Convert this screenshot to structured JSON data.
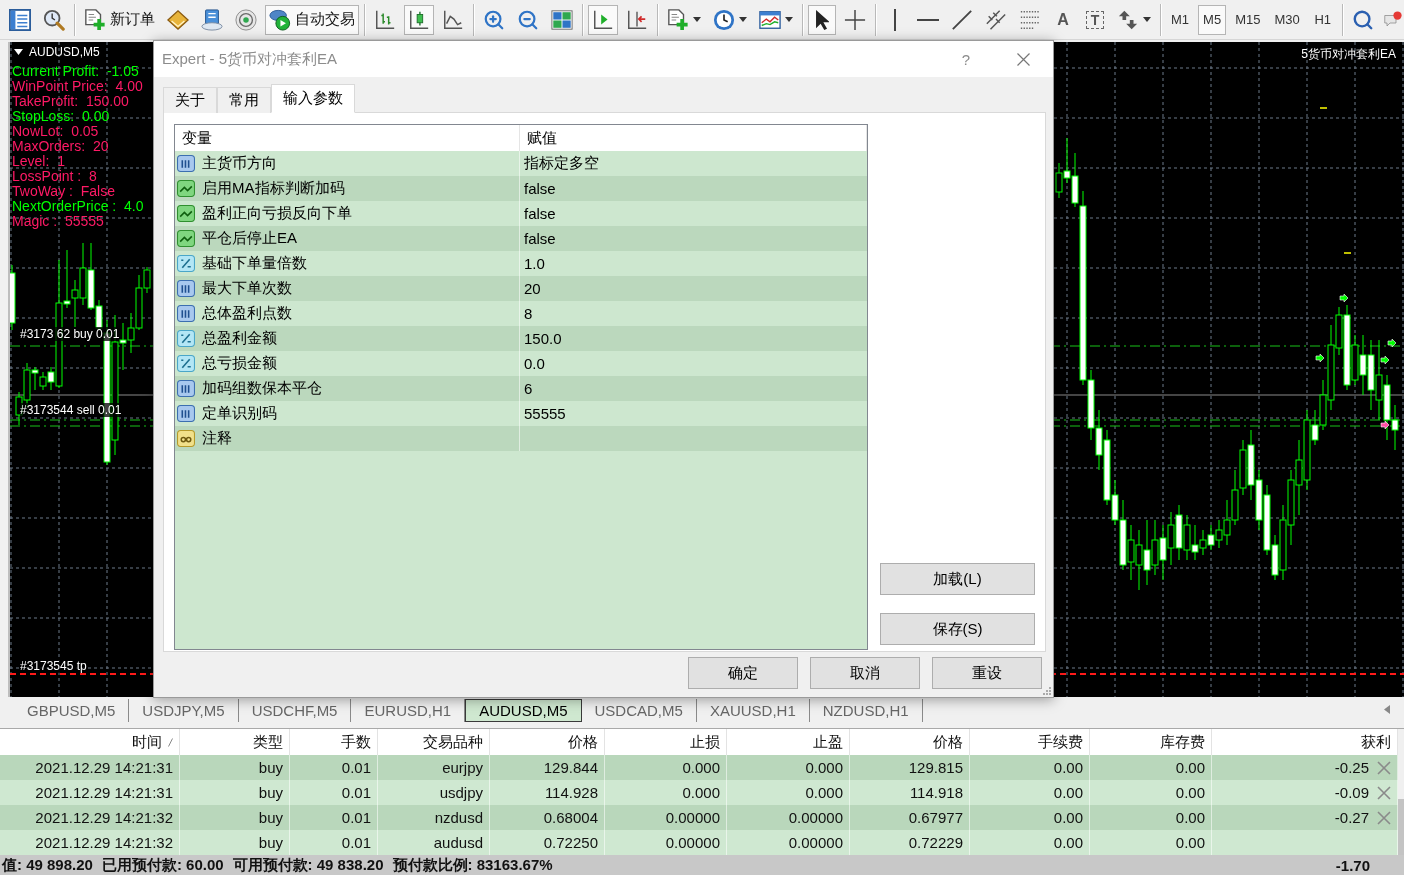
{
  "toolbar": {
    "groups": [
      [
        {
          "kind": "window"
        },
        {
          "kind": "history"
        }
      ],
      [
        {
          "kind": "order",
          "label": "新订单"
        },
        {
          "kind": "book"
        },
        {
          "kind": "server"
        },
        {
          "kind": "signal"
        },
        {
          "kind": "autotrade",
          "label": "自动交易",
          "on": true
        }
      ],
      [
        {
          "kind": "bars",
          "selected": false
        },
        {
          "kind": "candles",
          "selected": true
        },
        {
          "kind": "line",
          "selected": false
        }
      ],
      [
        {
          "kind": "zoomin"
        },
        {
          "kind": "zoomout"
        },
        {
          "kind": "tile"
        }
      ],
      [
        {
          "kind": "shift",
          "on": true
        },
        {
          "kind": "autoscroll",
          "on": false
        }
      ],
      [
        {
          "kind": "indicators",
          "menu": true
        },
        {
          "kind": "periods",
          "menu": true
        },
        {
          "kind": "templates",
          "menu": true
        }
      ],
      [
        {
          "kind": "cursor",
          "selected": true
        },
        {
          "kind": "crosshair",
          "selected": false
        }
      ],
      [
        {
          "kind": "vline"
        },
        {
          "kind": "hline"
        },
        {
          "kind": "trend"
        },
        {
          "kind": "channel"
        },
        {
          "kind": "fibo"
        },
        {
          "kind": "text",
          "label": "A"
        },
        {
          "kind": "label",
          "label": "T"
        },
        {
          "kind": "arrows",
          "menu": true
        }
      ],
      [
        {
          "kind": "period",
          "label": "M1",
          "selected": false
        },
        {
          "kind": "period",
          "label": "M5",
          "selected": true
        },
        {
          "kind": "period",
          "label": "M15",
          "selected": false
        },
        {
          "kind": "period",
          "label": "M30",
          "selected": false
        },
        {
          "kind": "period",
          "label": "H1",
          "selected": false
        }
      ],
      [
        {
          "kind": "search"
        },
        {
          "kind": "chat"
        }
      ]
    ]
  },
  "chart": {
    "symbol": "AUDUSD,M5",
    "info": [
      {
        "text": "Current Profit:  -1.05",
        "color": "#00ff00"
      },
      {
        "text": "WinPoint Price:  4.00",
        "color": "#ff1a66"
      },
      {
        "text": "TakeProfit:  150.00",
        "color": "#ff1a66"
      },
      {
        "text": "StopLoss:  0.00",
        "color": "#00ff00"
      },
      {
        "text": "NowLot:  0.05",
        "color": "#ff1a66"
      },
      {
        "text": "MaxOrders:  20",
        "color": "#ff1a66"
      },
      {
        "text": "Level:  1",
        "color": "#ff1a66"
      },
      {
        "text": "LossPoint :  8",
        "color": "#ff1a66"
      },
      {
        "text": "TwoWay :  False",
        "color": "#ff1a66"
      },
      {
        "text": "NextOrderPrice :  4.0",
        "color": "#00ff00"
      },
      {
        "text": "Magic :  55555",
        "color": "#ff1a66"
      }
    ],
    "orders": [
      "#3173 62 buy 0.01",
      "#3173544 sell 0.01",
      "#3173545 tp"
    ],
    "expert": "5货币对冲套利EA"
  },
  "dialog": {
    "title": "Expert - 5货币对冲套利EA",
    "help": "?",
    "tabs": [
      {
        "label": "关于",
        "selected": false
      },
      {
        "label": "常用",
        "selected": false
      },
      {
        "label": "输入参数",
        "selected": true
      }
    ],
    "inputs": {
      "columns": [
        "变量",
        "赋值"
      ],
      "rows": [
        {
          "kind": "int",
          "name": "主货币方向",
          "value": "指标定多空"
        },
        {
          "kind": "bool",
          "name": "启用MA指标判断加码",
          "value": "false"
        },
        {
          "kind": "bool",
          "name": "盈利正向亏损反向下单",
          "value": "false"
        },
        {
          "kind": "bool",
          "name": "平仓后停止EA",
          "value": "false"
        },
        {
          "kind": "double",
          "name": "基础下单量倍数",
          "value": "1.0"
        },
        {
          "kind": "int",
          "name": "最大下单次数",
          "value": "20"
        },
        {
          "kind": "int",
          "name": "总体盈利点数",
          "value": "8"
        },
        {
          "kind": "double",
          "name": "总盈利金额",
          "value": "150.0"
        },
        {
          "kind": "double",
          "name": "总亏损金额",
          "value": "0.0"
        },
        {
          "kind": "int",
          "name": "加码组数保本平仓",
          "value": "6"
        },
        {
          "kind": "int",
          "name": "定单识别码",
          "value": "55555"
        },
        {
          "kind": "string",
          "name": "注释"
        }
      ]
    },
    "side_buttons": [
      "加载(L)",
      "保存(S)"
    ],
    "buttons": [
      "确定",
      "取消",
      "重设"
    ]
  },
  "chart_tabs": [
    {
      "label": "GBPUSD,M5",
      "selected": false
    },
    {
      "label": "USDJPY,M5",
      "selected": false
    },
    {
      "label": "USDCHF,M5",
      "selected": false
    },
    {
      "label": "EURUSD,H1",
      "selected": false
    },
    {
      "label": "AUDUSD,M5",
      "selected": true
    },
    {
      "label": "USDCAD,M5",
      "selected": false
    },
    {
      "label": "XAUUSD,H1",
      "selected": false
    },
    {
      "label": "NZDUSD,H1",
      "selected": false
    }
  ],
  "trades": {
    "columns": [
      {
        "label": "时间",
        "sorted": true
      },
      {
        "label": "类型",
        "sorted": false
      },
      {
        "label": "手数",
        "sorted": false
      },
      {
        "label": "交易品种",
        "sorted": false
      },
      {
        "label": "价格",
        "sorted": false
      },
      {
        "label": "止损",
        "sorted": false
      },
      {
        "label": "止盈",
        "sorted": false
      },
      {
        "label": "价格",
        "sorted": false
      },
      {
        "label": "手续费",
        "sorted": false
      },
      {
        "label": "库存费",
        "sorted": false
      },
      {
        "label": "获利",
        "sorted": false
      }
    ],
    "rows": [
      {
        "cells": [
          "2021.12.29 14:21:31",
          "buy",
          "0.01",
          "eurjpy",
          "129.844",
          "0.000",
          "0.000",
          "129.815",
          "0.00",
          "0.00",
          "-0.25"
        ],
        "closable": true
      },
      {
        "cells": [
          "2021.12.29 14:21:31",
          "buy",
          "0.01",
          "usdjpy",
          "114.928",
          "0.000",
          "0.000",
          "114.918",
          "0.00",
          "0.00",
          "-0.09"
        ],
        "closable": true
      },
      {
        "cells": [
          "2021.12.29 14:21:32",
          "buy",
          "0.01",
          "nzdusd",
          "0.68004",
          "0.00000",
          "0.00000",
          "0.67977",
          "0.00",
          "0.00",
          "-0.27"
        ],
        "closable": true
      },
      {
        "cells": [
          "2021.12.29 14:21:32",
          "buy",
          "0.01",
          "audusd",
          "0.72250",
          "0.00000",
          "0.00000",
          "0.72229",
          "0.00",
          "0.00"
        ],
        "closable": false
      }
    ]
  },
  "status": {
    "items": [
      "值: 49 898.20",
      "已用预付款: 60.00",
      "可用预付款: 49 838.20",
      "预付款比例: 83163.67%"
    ],
    "total": "-1.70"
  }
}
